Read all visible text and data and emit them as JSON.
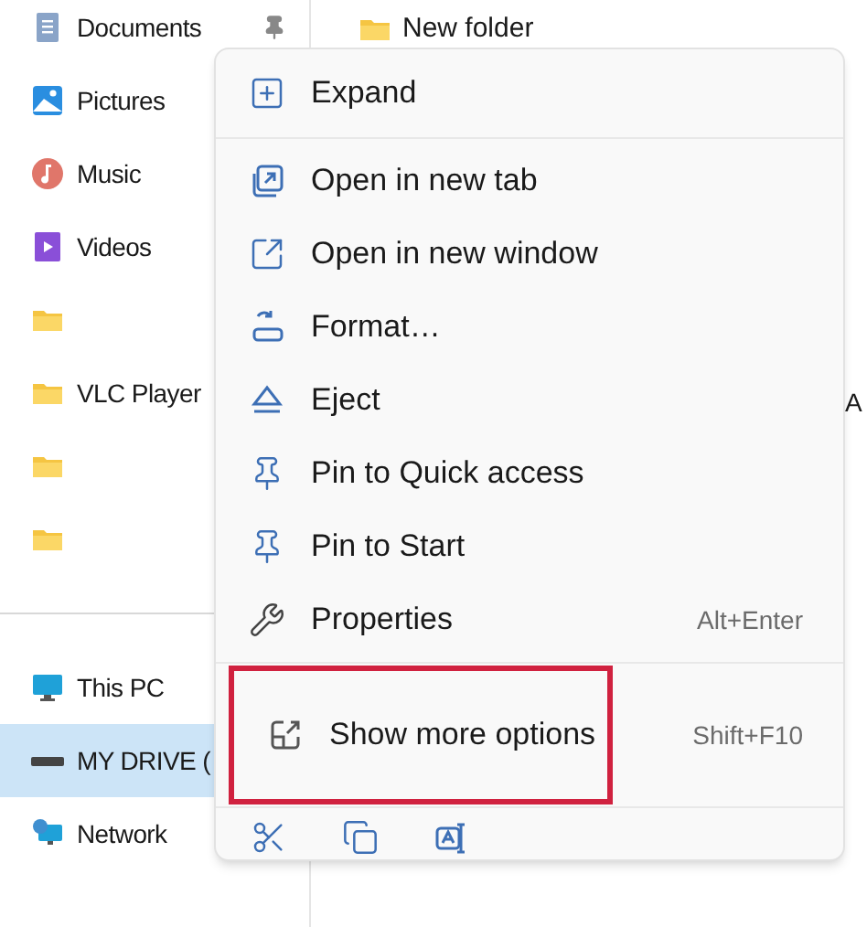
{
  "sidebar": {
    "groups": [
      {
        "items": [
          {
            "label": "Documents",
            "kind": "documents",
            "pinned": true,
            "selected": false
          },
          {
            "label": "Pictures",
            "kind": "pictures",
            "selected": false
          },
          {
            "label": "Music",
            "kind": "music",
            "selected": false
          },
          {
            "label": "Videos",
            "kind": "videos",
            "selected": false
          },
          {
            "kind": "folder",
            "selected": false
          },
          {
            "label": "VLC Player",
            "kind": "folder",
            "selected": false
          },
          {
            "kind": "folder",
            "selected": false
          },
          {
            "kind": "folder",
            "selected": false
          }
        ]
      },
      {
        "items": [
          {
            "label": "This PC",
            "kind": "pc",
            "selected": false
          },
          {
            "label": "MY DRIVE (",
            "kind": "drive",
            "selected": true
          },
          {
            "label": "Network",
            "kind": "network",
            "selected": false
          }
        ]
      }
    ]
  },
  "content": {
    "files": [
      {
        "name": "New folder"
      }
    ],
    "column_2": "A"
  },
  "context_menu": {
    "sections": [
      {
        "items": [
          {
            "label": "Expand",
            "highlighted": false
          }
        ]
      },
      {
        "items": [
          {
            "label": "Open in new tab",
            "highlighted": false
          },
          {
            "label": "Open in new window",
            "highlighted": false
          },
          {
            "label": "Format…",
            "highlighted": false
          },
          {
            "label": "Eject",
            "highlighted": false
          },
          {
            "label": "Pin to Quick access",
            "highlighted": false
          },
          {
            "label": "Pin to Start",
            "highlighted": false
          },
          {
            "label": "Properties",
            "shortcut": "Alt+Enter",
            "highlighted": false
          }
        ]
      },
      {
        "items": [
          {
            "label": "Show more options",
            "shortcut": "Shift+F10",
            "highlighted": true
          }
        ]
      }
    ]
  }
}
